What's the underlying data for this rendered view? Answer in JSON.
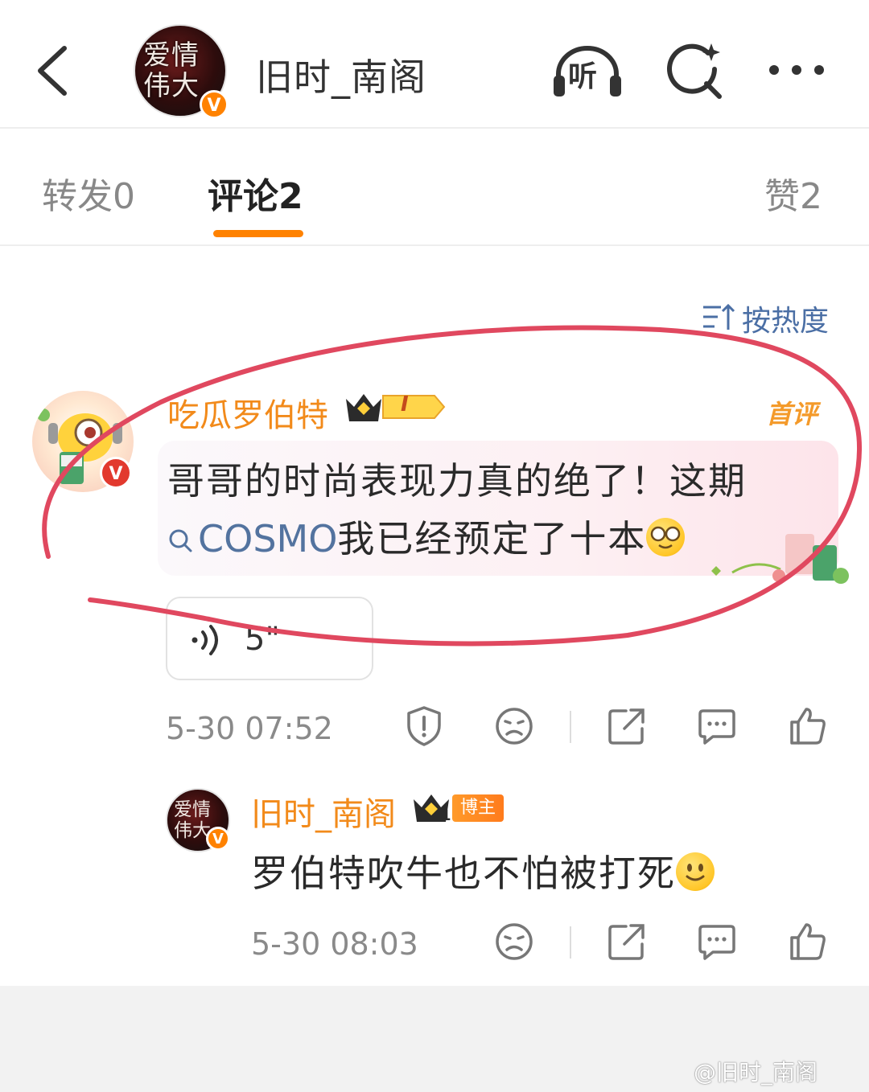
{
  "header": {
    "title": "旧时_南阁",
    "avatar_text": "爱情伟大",
    "verified_mark": "V",
    "listen_label": "听",
    "icons": [
      "back-arrow-icon",
      "headphones-icon",
      "search-icon",
      "more-icon"
    ]
  },
  "tabs": [
    {
      "label": "转发",
      "count": "0"
    },
    {
      "label": "评论",
      "count": "2",
      "active": true
    },
    {
      "label": "赞",
      "count": "2"
    }
  ],
  "sort": {
    "label": "按热度"
  },
  "comments": [
    {
      "user": "吃瓜罗伯特",
      "level_badge": "I",
      "verified_mark": "V",
      "first_tag": "首评",
      "text_part1": "哥哥的时尚表现力真的绝了！这期",
      "topic": "COSMO",
      "text_part2": "我已经预定了十本",
      "emoji": "smiling-face-with-glasses",
      "voice_duration": "5\"",
      "time": "5-30 07:52",
      "actions": [
        "report-icon",
        "sad-face-icon",
        "share-icon",
        "comment-icon",
        "like-icon"
      ]
    }
  ],
  "reply": {
    "user": "旧时_南阁",
    "avatar_text": "爱情伟大",
    "verified_mark": "V",
    "level_badge": "1",
    "role_badge": "博主",
    "text": "罗伯特吹牛也不怕被打死",
    "emoji": "slightly-smiling-face",
    "time": "5-30 08:03",
    "actions": [
      "sad-face-icon",
      "share-icon",
      "comment-icon",
      "like-icon"
    ]
  },
  "watermark": "@旧时_南阁",
  "colors": {
    "accent_orange": "#ff8200",
    "username_orange": "#f28a1a",
    "link_blue": "#53739f",
    "annotation_red": "#e0485f"
  }
}
